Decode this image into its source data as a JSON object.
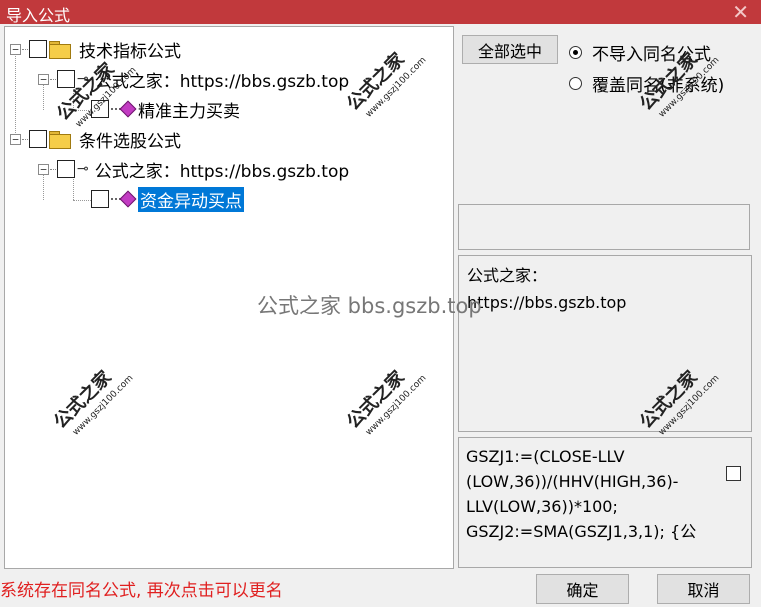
{
  "window": {
    "title": "导入公式",
    "close_glyph": "✕"
  },
  "tree": {
    "items": [
      {
        "label": "技术指标公式",
        "expander": "−",
        "icon": "folder-icon"
      },
      {
        "label": "公式之家：https://bbs.gszb.top",
        "expander": "−",
        "icon": "key-icon"
      },
      {
        "label": "精准主力买卖",
        "icon": "formula-icon"
      },
      {
        "label": "条件选股公式",
        "expander": "−",
        "icon": "folder-icon"
      },
      {
        "label": "公式之家：https://bbs.gszb.top",
        "expander": "−",
        "icon": "key-icon"
      },
      {
        "label": "资金异动买点",
        "icon": "formula-icon",
        "selected": true
      }
    ],
    "key_glyph": "⊸"
  },
  "right": {
    "select_all_label": "全部选中",
    "radio_options": [
      {
        "label": "不导入同名公式",
        "checked": true
      },
      {
        "label": "覆盖同名(非系统)",
        "checked": false
      }
    ],
    "description": "公式之家：\nhttps://bbs.gszb.top",
    "code": "GSZJ1:=(CLOSE-LLV\n(LOW,36))/(HHV(HIGH,36)-\nLLV(LOW,36))*100;\nGSZJ2:=SMA(GSZJ1,3,1); {公"
  },
  "status_text": "系统存在同名公式, 再次点击可以更名",
  "ok_label": "确定",
  "cancel_label": "取消",
  "watermarks": {
    "stamp_text": "公式之家",
    "stamp_url": "www.gszj100.com",
    "center_text": "公式之家 bbs.gszb.top"
  },
  "colors": {
    "title_bar": "#c1393c",
    "selection": "#0078d7",
    "status_text": "#e02020",
    "formula_gem": "#c23bc2"
  }
}
